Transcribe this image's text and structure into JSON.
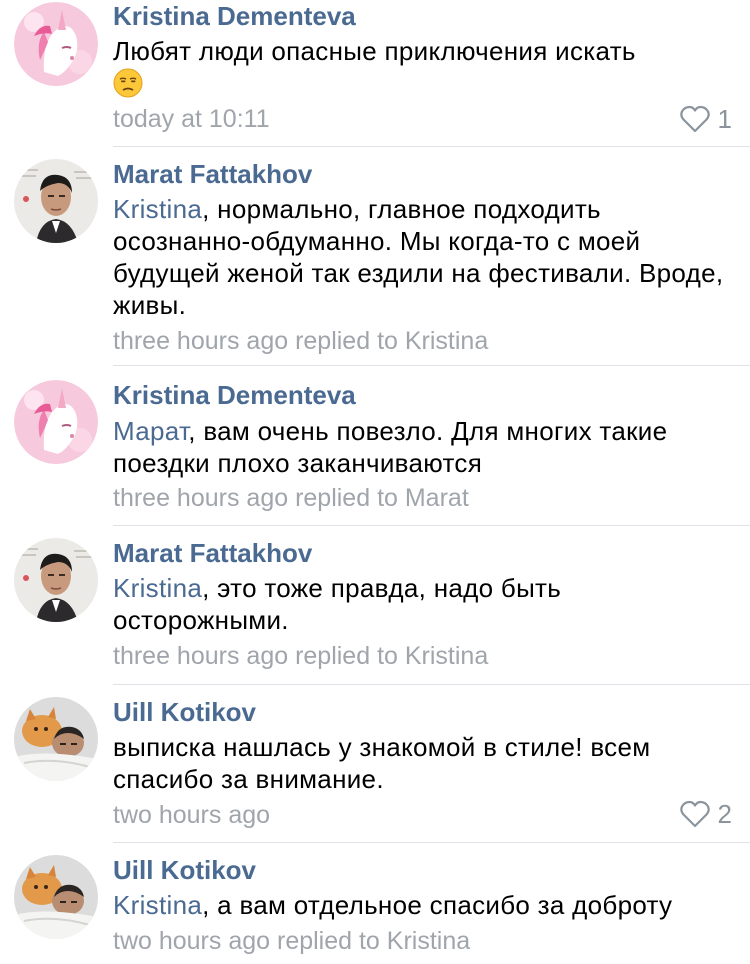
{
  "comments": [
    {
      "author": "Kristina Dementeva",
      "mention": "",
      "text": "Любят люди опасные приключения искать",
      "meta": "today at 10:11",
      "likes": "1",
      "emoji": "unamused-face-emoji",
      "avatar": "pink-unicorn-avatar"
    },
    {
      "author": "Marat Fattakhov",
      "mention": "Kristina",
      "text": ", нормально, главное подходить осознанно-обдуманно. Мы когда-то с моей будущей женой так ездили на фестивали. Вроде, живы.",
      "meta": "three hours ago replied to Kristina",
      "avatar": "man-portrait-avatar"
    },
    {
      "author": "Kristina Dementeva",
      "mention": "Марат",
      "text": ", вам очень повезло. Для многих такие поездки плохо заканчиваются",
      "meta": "three hours ago replied to Marat",
      "avatar": "pink-unicorn-avatar"
    },
    {
      "author": "Marat Fattakhov",
      "mention": "Kristina",
      "text": ", это тоже правда, надо быть осторожными.",
      "meta": "three hours ago replied to Kristina",
      "avatar": "man-portrait-avatar"
    },
    {
      "author": "Uill Kotikov",
      "mention": "",
      "text": "выписка нашлась у знакомой в стиле! всем спасибо за внимание.",
      "meta": "two hours ago",
      "likes": "2",
      "avatar": "man-with-cat-avatar"
    },
    {
      "author": "Uill Kotikov",
      "mention": "Kristina",
      "text": ", а вам отдельное спасибо за доброту",
      "meta": "two hours ago replied to Kristina",
      "avatar": "man-with-cat-avatar"
    }
  ],
  "colors": {
    "author": "#4a6a92",
    "meta": "#a0a5ab",
    "separator": "#dfe2e6"
  }
}
